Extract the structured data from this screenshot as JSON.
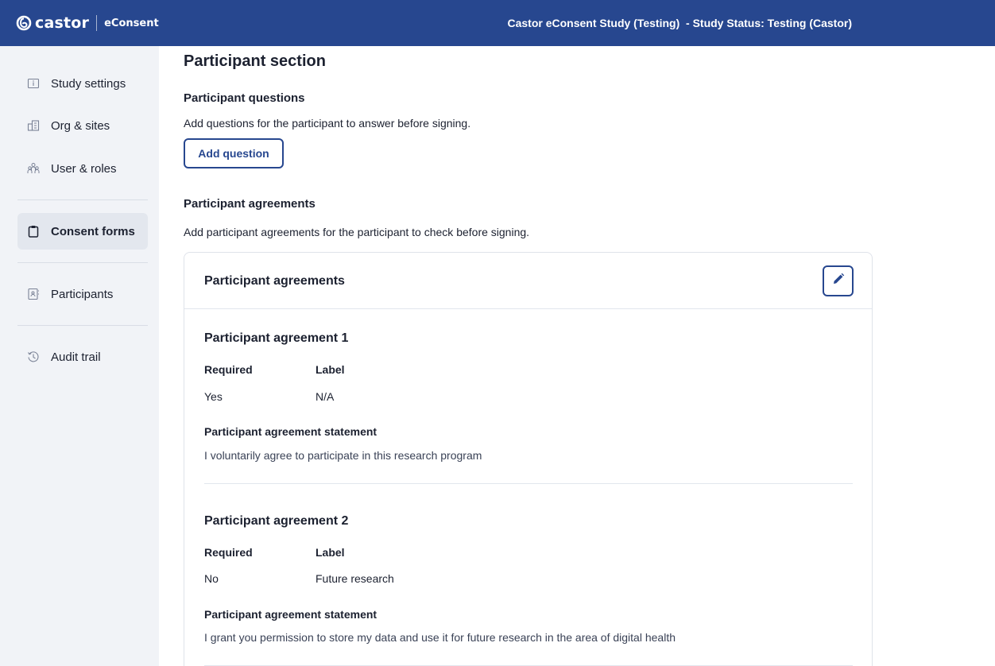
{
  "header": {
    "brand_name": "castor",
    "product_name": "eConsent",
    "study_status": "Castor eConsent Study (Testing)  - Study Status: Testing (Castor)"
  },
  "sidebar": {
    "items": [
      {
        "label": "Study settings",
        "icon": "info-window-icon",
        "active": false
      },
      {
        "label": "Org & sites",
        "icon": "building-icon",
        "active": false
      },
      {
        "label": "User & roles",
        "icon": "users-icon",
        "active": false
      },
      {
        "label": "Consent forms",
        "icon": "clipboard-icon",
        "active": true
      },
      {
        "label": "Participants",
        "icon": "contact-book-icon",
        "active": false
      },
      {
        "label": "Audit trail",
        "icon": "history-icon",
        "active": false
      }
    ]
  },
  "main": {
    "title": "Participant section",
    "questions": {
      "heading": "Participant questions",
      "description": "Add questions for the participant to answer before signing.",
      "button_label": "Add question"
    },
    "agreements": {
      "heading": "Participant agreements",
      "description": "Add participant agreements for the participant to check before signing.",
      "card_title": "Participant agreements",
      "required_header": "Required",
      "label_header": "Label",
      "statement_header": "Participant agreement statement",
      "items": [
        {
          "title": "Participant agreement 1",
          "required": "Yes",
          "label": "N/A",
          "statement": "I voluntarily agree to participate in this research program"
        },
        {
          "title": "Participant agreement 2",
          "required": "No",
          "label": "Future research",
          "statement": "I grant you permission to store my data and use it for future research in the area of digital health"
        }
      ]
    }
  },
  "colors": {
    "brand_blue": "#27478f",
    "sidebar_bg": "#f1f3f7",
    "active_item_bg": "#e3e7ee"
  }
}
